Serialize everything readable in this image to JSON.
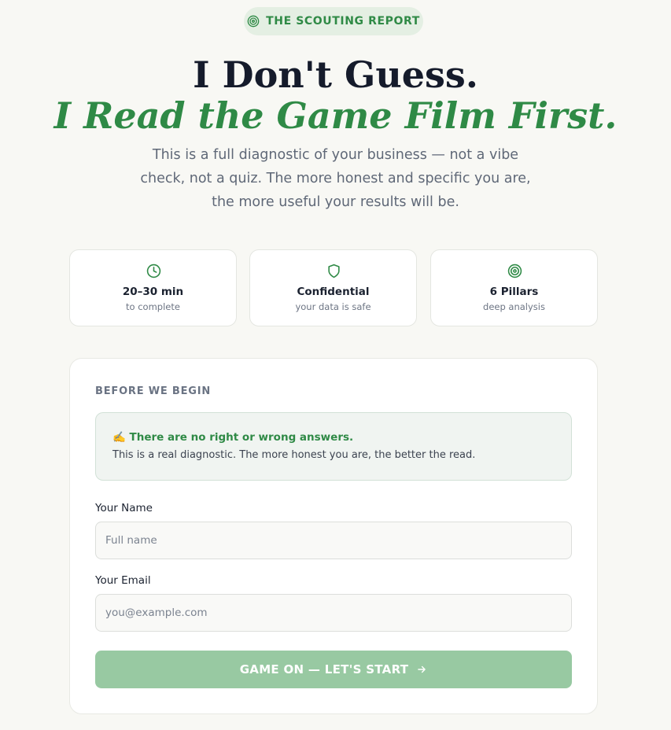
{
  "badge": {
    "label": "THE SCOUTING REPORT",
    "icon": "target-icon"
  },
  "headline": {
    "line1": "I Don't Guess.",
    "line2": "I Read the Game Film First."
  },
  "intro": "This is a full diagnostic of your business — not a vibe check, not a quiz. The more honest and specific you are, the more useful your results will be.",
  "stats": [
    {
      "icon": "clock-icon",
      "title": "20–30 min",
      "subtitle": "to complete"
    },
    {
      "icon": "shield-icon",
      "title": "Confidential",
      "subtitle": "your data is safe"
    },
    {
      "icon": "target-icon",
      "title": "6 Pillars",
      "subtitle": "deep analysis"
    }
  ],
  "form": {
    "heading": "BEFORE WE BEGIN",
    "notice": {
      "title": "✍️ There are no right or wrong answers.",
      "body": "This is a real diagnostic. The more honest you are, the better the read."
    },
    "name_label": "Your Name",
    "name_value": "",
    "name_placeholder": "Full name",
    "email_label": "Your Email",
    "email_value": "",
    "email_placeholder": "you@example.com",
    "submit_label": "GAME ON — LET'S START"
  },
  "colors": {
    "accent": "#2f8a46",
    "accent_soft": "#98c9a2",
    "background": "#f8f8f4",
    "heading": "#151b2b"
  }
}
